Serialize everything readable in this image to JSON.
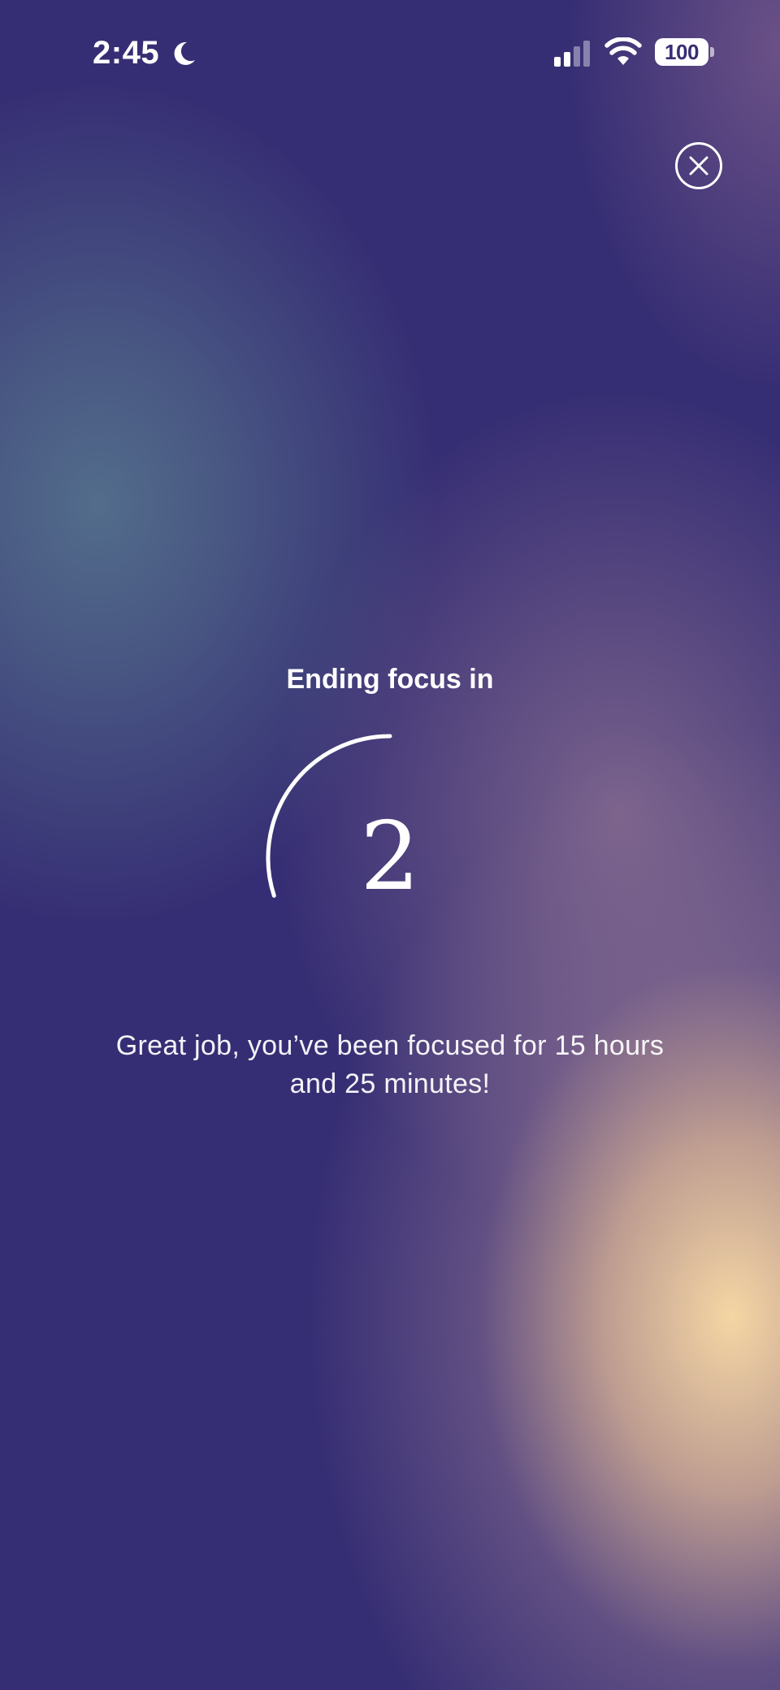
{
  "status_bar": {
    "time": "2:45",
    "focus_icon": "moon-icon",
    "signal_icon": "cellular-signal-icon",
    "wifi_icon": "wifi-icon",
    "battery": "100"
  },
  "close_button": {
    "icon": "close-icon"
  },
  "countdown": {
    "label": "Ending focus in",
    "value": "2",
    "ring_progress": 0.3
  },
  "message": "Great job, you’ve been focused for 15 hours and 25 minutes!",
  "colors": {
    "background_base": "#362e74",
    "accent_teal": "#54708c",
    "accent_peach": "#f4d6a4",
    "foreground": "#ffffff"
  }
}
